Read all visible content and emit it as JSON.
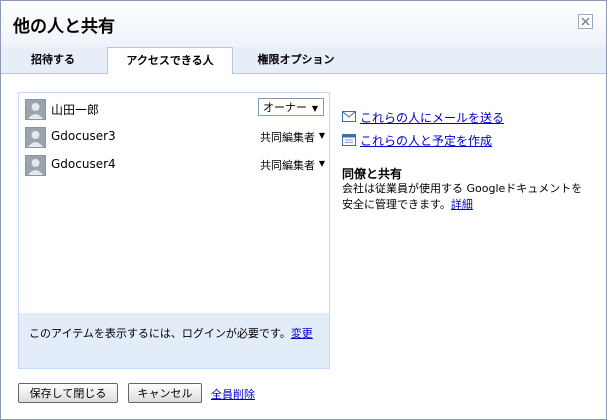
{
  "dialog": {
    "title": "他の人と共有",
    "close_label": "×"
  },
  "tabs": [
    {
      "label": "招待する",
      "active": false
    },
    {
      "label": "アクセスできる人",
      "active": true
    },
    {
      "label": "権限オプション",
      "active": false
    }
  ],
  "users": [
    {
      "name": "山田一郎",
      "role": "オーナー"
    },
    {
      "name": "Gdocuser3",
      "role": "共同編集者"
    },
    {
      "name": "Gdocuser4",
      "role": "共同編集者"
    }
  ],
  "dropdown_arrow": "▼",
  "notice": {
    "text": "このアイテムを表示するには、ログインが必要です。",
    "link": "変更"
  },
  "side_links": {
    "email": "これらの人にメールを送る",
    "calendar": "これらの人と予定を作成"
  },
  "info": {
    "title": "同僚と共有",
    "text": "会社は従業員が使用する Googleドキュメントを安全に管理できます。",
    "link": "詳細"
  },
  "buttons": {
    "save_close": "保存して閉じる",
    "cancel": "キャンセル",
    "delete_all": "全員削除"
  },
  "colors": {
    "link": "#0000cc",
    "tab_bar": "#e8eef7",
    "notice_bg": "#e3ecf9",
    "list_border": "#c3d9ff"
  }
}
